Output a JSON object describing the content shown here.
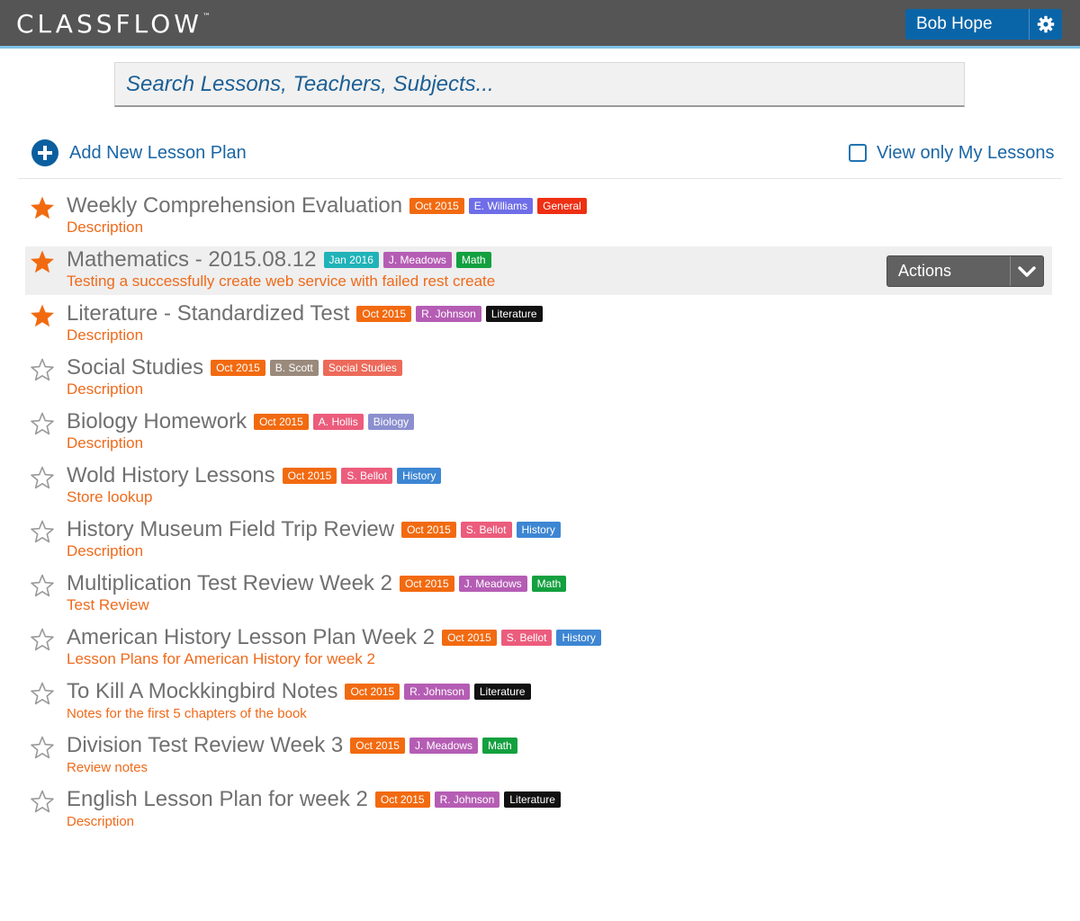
{
  "app": {
    "logo": "CLASSFLOW",
    "logo_tm": "™",
    "user_name": "Bob Hope"
  },
  "search": {
    "placeholder": "Search Lessons, Teachers, Subjects..."
  },
  "toolbar": {
    "add_label": "Add New Lesson Plan",
    "view_only_label": "View only My Lessons",
    "view_only_checked": false
  },
  "colors": {
    "header_bg": "#555555",
    "accent_blue": "#0a65a8",
    "date_tag": "#f26a10",
    "desc_orange": "#ef6a1b",
    "star_active": "#f26a10"
  },
  "lessons": [
    {
      "title": "Weekly Comprehension Evaluation",
      "starred": true,
      "description": "Description",
      "tags": [
        {
          "text": "Oct 2015",
          "color": "#f26a10"
        },
        {
          "text": "E. Williams",
          "color": "#6f6ee8"
        },
        {
          "text": "General",
          "color": "#ee2f13"
        }
      ]
    },
    {
      "title": "Mathematics - 2015.08.12",
      "starred": true,
      "description": "Testing a successfully create web service with failed rest create",
      "highlight": true,
      "actions_label": "Actions",
      "tags": [
        {
          "text": "Jan 2016",
          "color": "#1fb3b8"
        },
        {
          "text": "J. Meadows",
          "color": "#b55db4"
        },
        {
          "text": "Math",
          "color": "#13a03f"
        }
      ]
    },
    {
      "title": "Literature - Standardized Test",
      "starred": true,
      "description": "Description",
      "tags": [
        {
          "text": "Oct 2015",
          "color": "#f26a10"
        },
        {
          "text": "R. Johnson",
          "color": "#b55db4"
        },
        {
          "text": "Literature",
          "color": "#111111"
        }
      ]
    },
    {
      "title": "Social Studies",
      "starred": false,
      "description": "Description",
      "tags": [
        {
          "text": "Oct 2015",
          "color": "#f26a10"
        },
        {
          "text": "B. Scott",
          "color": "#9a8a7c"
        },
        {
          "text": "Social Studies",
          "color": "#ec6a5a"
        }
      ]
    },
    {
      "title": "Biology Homework",
      "starred": false,
      "description": "Description",
      "tags": [
        {
          "text": "Oct 2015",
          "color": "#f26a10"
        },
        {
          "text": "A. Hollis",
          "color": "#ec5c7c"
        },
        {
          "text": "Biology",
          "color": "#8b8fcf"
        }
      ]
    },
    {
      "title": "Wold History Lessons",
      "starred": false,
      "description": "Store lookup",
      "tags": [
        {
          "text": "Oct 2015",
          "color": "#f26a10"
        },
        {
          "text": "S. Bellot",
          "color": "#ec5c7c"
        },
        {
          "text": "History",
          "color": "#3d86d3"
        }
      ]
    },
    {
      "title": "History Museum Field Trip Review",
      "starred": false,
      "description": "Description",
      "tags": [
        {
          "text": "Oct 2015",
          "color": "#f26a10"
        },
        {
          "text": "S. Bellot",
          "color": "#ec5c7c"
        },
        {
          "text": "History",
          "color": "#3d86d3"
        }
      ]
    },
    {
      "title": "Multiplication Test Review Week 2",
      "starred": false,
      "description": "Test Review",
      "tags": [
        {
          "text": "Oct 2015",
          "color": "#f26a10"
        },
        {
          "text": "J. Meadows",
          "color": "#b55db4"
        },
        {
          "text": "Math",
          "color": "#13a03f"
        }
      ]
    },
    {
      "title": "American History Lesson Plan Week 2",
      "starred": false,
      "description": "Lesson Plans for American History for week 2",
      "tags": [
        {
          "text": "Oct 2015",
          "color": "#f26a10"
        },
        {
          "text": "S. Bellot",
          "color": "#ec5c7c"
        },
        {
          "text": "History",
          "color": "#3d86d3"
        }
      ]
    },
    {
      "title": "To Kill A Mockkingbird Notes",
      "starred": false,
      "description": "Notes for the first 5 chapters of the book",
      "small_desc": true,
      "tags": [
        {
          "text": "Oct 2015",
          "color": "#f26a10"
        },
        {
          "text": "R. Johnson",
          "color": "#b55db4"
        },
        {
          "text": "Literature",
          "color": "#111111"
        }
      ]
    },
    {
      "title": "Division Test Review Week 3",
      "starred": false,
      "description": "Review notes",
      "small_desc": true,
      "tags": [
        {
          "text": "Oct 2015",
          "color": "#f26a10"
        },
        {
          "text": "J. Meadows",
          "color": "#b55db4"
        },
        {
          "text": "Math",
          "color": "#13a03f"
        }
      ]
    },
    {
      "title": "English Lesson Plan for week 2",
      "starred": false,
      "description": "Description",
      "small_desc": true,
      "tags": [
        {
          "text": "Oct 2015",
          "color": "#f26a10"
        },
        {
          "text": "R. Johnson",
          "color": "#b55db4"
        },
        {
          "text": "Literature",
          "color": "#111111"
        }
      ]
    }
  ]
}
